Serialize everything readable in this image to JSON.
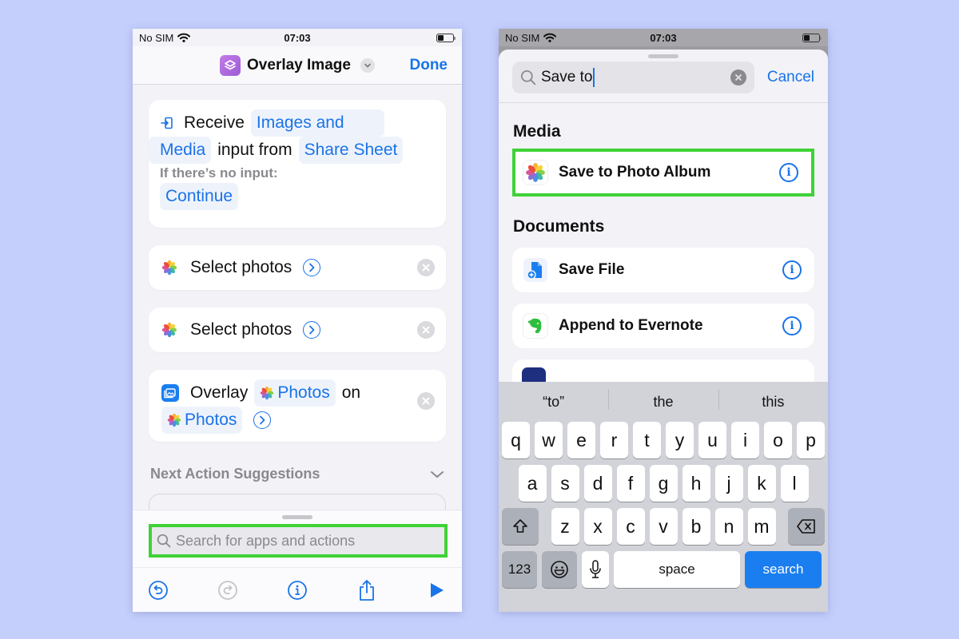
{
  "background_color": "#c5cffc",
  "left_screen": {
    "status_bar": {
      "carrier": "No SIM",
      "time": "07:03"
    },
    "nav": {
      "title": "Overlay Image",
      "done_label": "Done",
      "app_icon": "layers-icon"
    },
    "receive_action": {
      "verb": "Receive",
      "type_token_line1": "Images and",
      "type_token_line2": "Media",
      "connector": "input from",
      "source_token": "Share Sheet",
      "no_input_label": "If there’s no input:",
      "no_input_token": "Continue"
    },
    "actions": [
      {
        "label": "Select photos",
        "icon": "photos-icon"
      },
      {
        "label": "Select photos",
        "icon": "photos-icon"
      }
    ],
    "overlay_action": {
      "verb": "Overlay",
      "first_token": "Photos",
      "connector": "on",
      "second_token": "Photos"
    },
    "suggestions": {
      "label": "Next Action Suggestions"
    },
    "search": {
      "placeholder": "Search for apps and actions"
    },
    "toolbar": [
      "undo-icon",
      "redo-icon",
      "info-icon",
      "share-icon",
      "play-icon"
    ]
  },
  "right_screen": {
    "status_bar": {
      "carrier": "No SIM",
      "time": "07:03"
    },
    "search": {
      "value": "Save to",
      "cancel_label": "Cancel"
    },
    "sections": [
      {
        "title": "Media",
        "items": [
          {
            "label": "Save to Photo Album",
            "icon": "photos-icon",
            "highlighted": true
          }
        ]
      },
      {
        "title": "Documents",
        "items": [
          {
            "label": "Save File",
            "icon": "files-icon"
          },
          {
            "label": "Append to Evernote",
            "icon": "evernote-icon"
          }
        ]
      }
    ],
    "keyboard": {
      "predictions": [
        "“to”",
        "the",
        "this"
      ],
      "row1": [
        "q",
        "w",
        "e",
        "r",
        "t",
        "y",
        "u",
        "i",
        "o",
        "p"
      ],
      "row2": [
        "a",
        "s",
        "d",
        "f",
        "g",
        "h",
        "j",
        "k",
        "l"
      ],
      "row3": [
        "z",
        "x",
        "c",
        "v",
        "b",
        "n",
        "m"
      ],
      "numbers_label": "123",
      "space_label": "space",
      "return_label": "search"
    }
  },
  "highlight_color": "#3fd236",
  "accent_color": "#1a73e8"
}
